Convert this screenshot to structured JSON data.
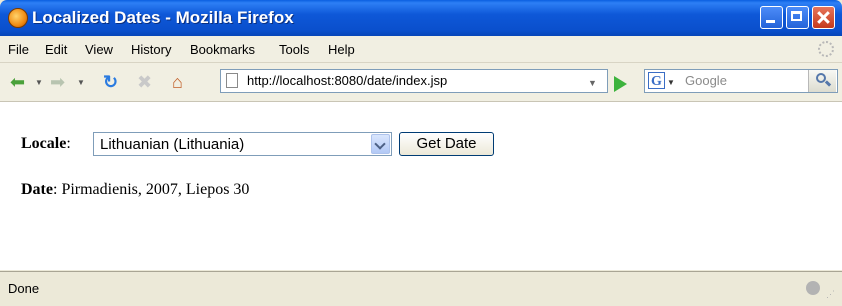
{
  "window": {
    "title": "Localized Dates - Mozilla Firefox"
  },
  "menu": {
    "items": [
      "File",
      "Edit",
      "View",
      "History",
      "Bookmarks",
      "Tools",
      "Help"
    ]
  },
  "navigation": {
    "url": "http://localhost:8080/date/index.jsp",
    "search_placeholder": "Google"
  },
  "form": {
    "locale_label": "Locale",
    "locale_colon": ":",
    "locale_selected": "Lithuanian (Lithuania)",
    "button_label": "Get Date"
  },
  "result": {
    "date_label": "Date",
    "date_colon": ":",
    "date_value": "Pirmadienis, 2007, Liepos 30"
  },
  "status": {
    "text": "Done"
  },
  "colors": {
    "titlebar": "#0a4fcc",
    "close_button": "#c4391c",
    "go_arrow": "#3db33d"
  }
}
